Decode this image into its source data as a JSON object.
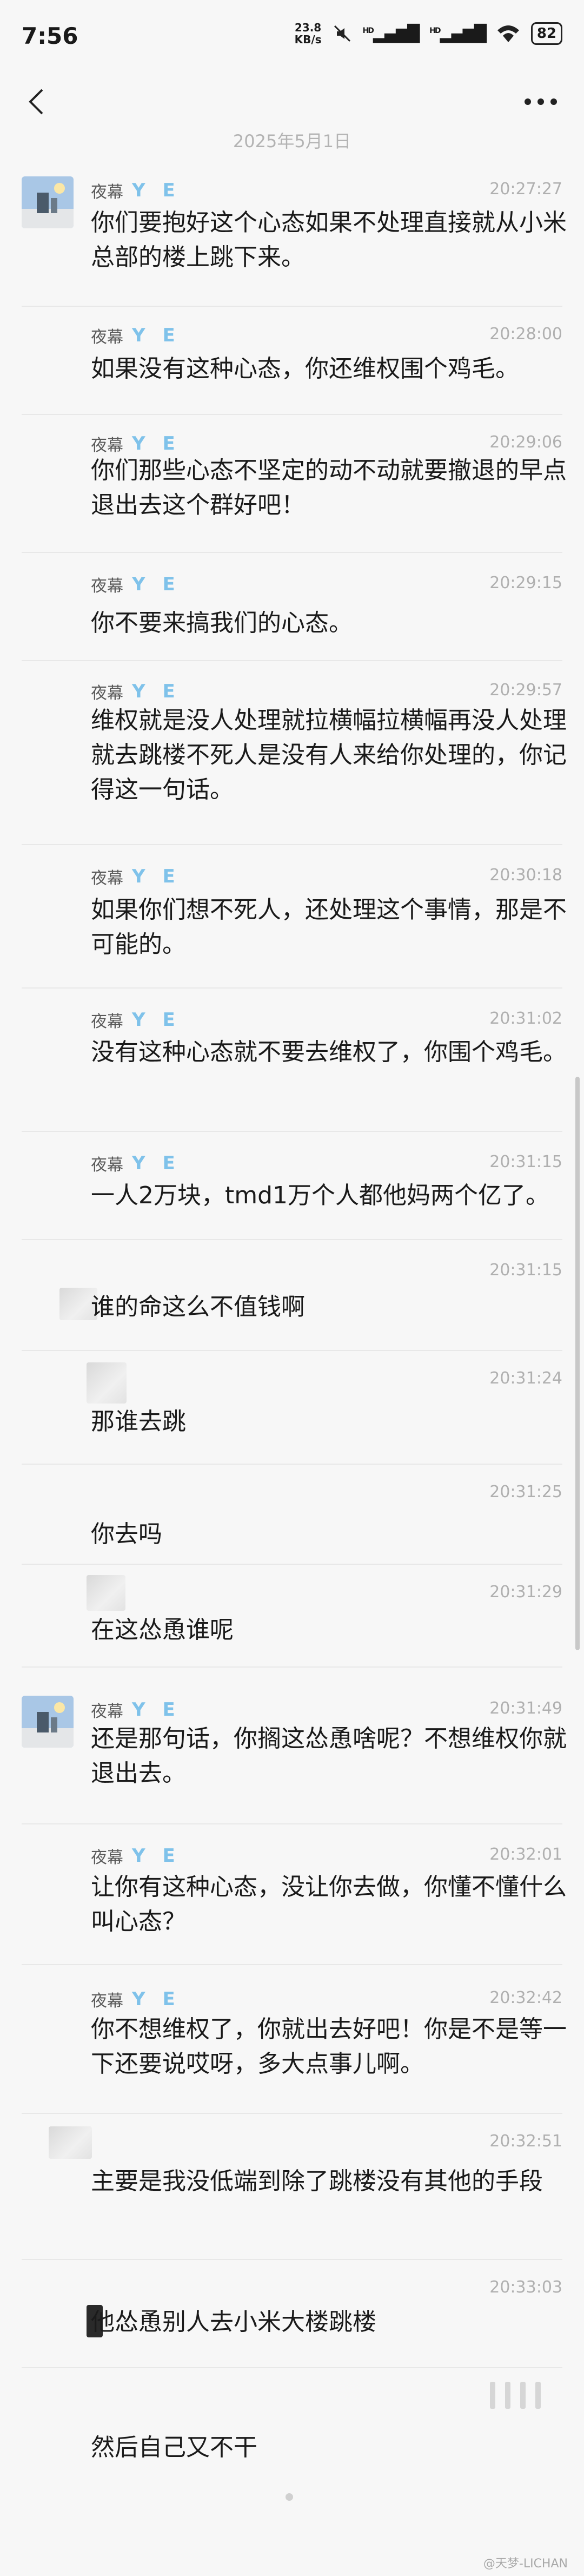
{
  "status": {
    "time": "7:56",
    "net_speed_top": "23.8",
    "net_speed_bottom": "KB/s",
    "battery": "82",
    "hd1": "HD",
    "hd2": "HD"
  },
  "date_separator": "2025年5月1日",
  "messages": [
    {
      "sender": "夜幕",
      "sender_tag": "Y E",
      "time": "20:27:27",
      "text": "你们要抱好这个心态如果不处理直接就从小米总部的楼上跳下来。",
      "avatar": "landscape"
    },
    {
      "sender": "夜幕",
      "sender_tag": "Y E",
      "time": "20:28:00",
      "text": "如果没有这种心态，你还维权围个鸡毛。"
    },
    {
      "sender": "夜幕",
      "sender_tag": "Y E",
      "time": "20:29:06",
      "text": "你们那些心态不坚定的动不动就要撤退的早点退出去这个群好吧！"
    },
    {
      "sender": "夜幕",
      "sender_tag": "Y E",
      "time": "20:29:15",
      "text": "你不要来搞我们的心态。"
    },
    {
      "sender": "夜幕",
      "sender_tag": "Y E",
      "time": "20:29:57",
      "text": "维权就是没人处理就拉横幅拉横幅再没人处理就去跳楼不死人是没有人来给你处理的，你记得这一句话。"
    },
    {
      "sender": "夜幕",
      "sender_tag": "Y E",
      "time": "20:30:18",
      "text": "如果你们想不死人，还处理这个事情，那是不可能的。"
    },
    {
      "sender": "夜幕",
      "sender_tag": "Y E",
      "time": "20:31:02",
      "text": "没有这种心态就不要去维权了，你围个鸡毛。"
    },
    {
      "sender": "夜幕",
      "sender_tag": "Y E",
      "time": "20:31:15",
      "text": "一人2万块，tmd1万个人都他妈两个亿了。"
    },
    {
      "sender": "",
      "sender_tag": "",
      "time": "20:31:15",
      "text": "谁的命这么不值钱啊"
    },
    {
      "sender": "",
      "sender_tag": "",
      "time": "20:31:24",
      "text": "那谁去跳"
    },
    {
      "sender": "",
      "sender_tag": "",
      "time": "20:31:25",
      "text": "你去吗"
    },
    {
      "sender": "",
      "sender_tag": "",
      "time": "20:31:29",
      "text": "在这怂恿谁呢"
    },
    {
      "sender": "夜幕",
      "sender_tag": "Y E",
      "time": "20:31:49",
      "text": "还是那句话，你搁这怂恿啥呢？不想维权你就退出去。",
      "avatar": "landscape"
    },
    {
      "sender": "夜幕",
      "sender_tag": "Y E",
      "time": "20:32:01",
      "text": "让你有这种心态，没让你去做，你懂不懂什么叫心态？"
    },
    {
      "sender": "夜幕",
      "sender_tag": "Y E",
      "time": "20:32:42",
      "text": "你不想维权了，你就出去好吧！你是不是等一下还要说哎呀，多大点事儿啊。"
    },
    {
      "sender": "",
      "sender_tag": "",
      "time": "20:32:51",
      "text": "主要是我没低端到除了跳楼没有其他的手段"
    },
    {
      "sender": "",
      "sender_tag": "",
      "time": "20:33:03",
      "text": "他怂恿别人去小米大楼跳楼"
    },
    {
      "sender": "",
      "sender_tag": "",
      "time": "",
      "text": "然后自己又不干"
    }
  ],
  "watermark": "@天梦-LICHAN"
}
